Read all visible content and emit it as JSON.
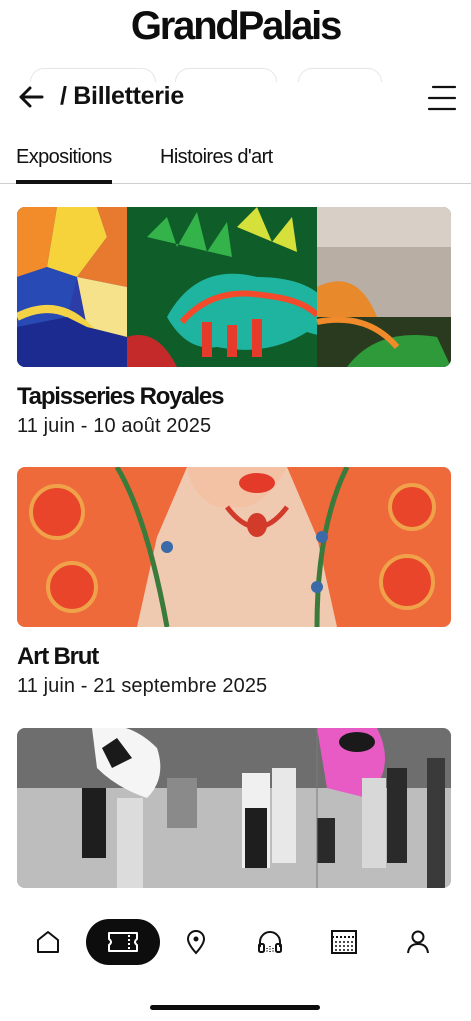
{
  "header": {
    "brand": "GrandPalais",
    "breadcrumb": "/ Billetterie"
  },
  "tabs": [
    {
      "label": "Expositions",
      "active": true
    },
    {
      "label": "Histoires d'art",
      "active": false
    }
  ],
  "exhibitions": [
    {
      "title": "Tapisseries Royales",
      "dates": "11 juin - 10 août 2025"
    },
    {
      "title": "Art Brut",
      "dates": "11 juin - 21 septembre 2025"
    },
    {
      "title": "",
      "dates": ""
    }
  ],
  "bottom_nav": [
    {
      "icon": "home-icon",
      "active": false
    },
    {
      "icon": "ticket-icon",
      "active": true
    },
    {
      "icon": "location-pin-icon",
      "active": false
    },
    {
      "icon": "audioguide-icon",
      "active": false
    },
    {
      "icon": "calendar-icon",
      "active": false
    },
    {
      "icon": "profile-icon",
      "active": false
    }
  ],
  "colors": {
    "text": "#111111",
    "active_nav": "#0d0d0d",
    "background": "#ffffff",
    "divider": "#cfcfcf"
  }
}
